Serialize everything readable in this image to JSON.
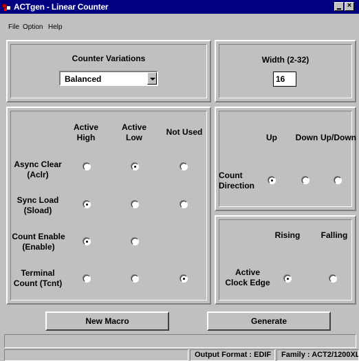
{
  "window": {
    "title": "ACTgen - Linear Counter"
  },
  "menu": {
    "file": "File",
    "option": "Option",
    "help": "Help"
  },
  "variations": {
    "label": "Counter Variations",
    "selected": "Balanced"
  },
  "width": {
    "label": "Width (2-32)",
    "value": "16"
  },
  "polarity": {
    "columns": [
      "Active\nHigh",
      "Active\nLow",
      "Not Used"
    ],
    "rows": [
      {
        "label": "Async Clear\n(Aclr)",
        "checked": "Active Low"
      },
      {
        "label": "Sync Load\n(Sload)",
        "checked": "Active High"
      },
      {
        "label": "Count Enable\n(Enable)",
        "checked": "Active High"
      },
      {
        "label": "Terminal\nCount (Tcnt)",
        "checked": "Not Used"
      }
    ]
  },
  "direction": {
    "columns": [
      "Up",
      "Down",
      "Up/Down"
    ],
    "label": "Count\nDirection",
    "selected": "Up"
  },
  "clock": {
    "columns": [
      "Rising",
      "Falling"
    ],
    "label": "Active\nClock Edge",
    "selected": "Rising"
  },
  "buttons": {
    "new_macro": "New Macro",
    "generate": "Generate"
  },
  "status": {
    "output_format": "Output Format : EDIF",
    "family": "Family : ACT2/1200XL"
  },
  "colors": {
    "titlebar": "#000080",
    "face": "#c0c0c0",
    "app_icon": "#c00000"
  }
}
